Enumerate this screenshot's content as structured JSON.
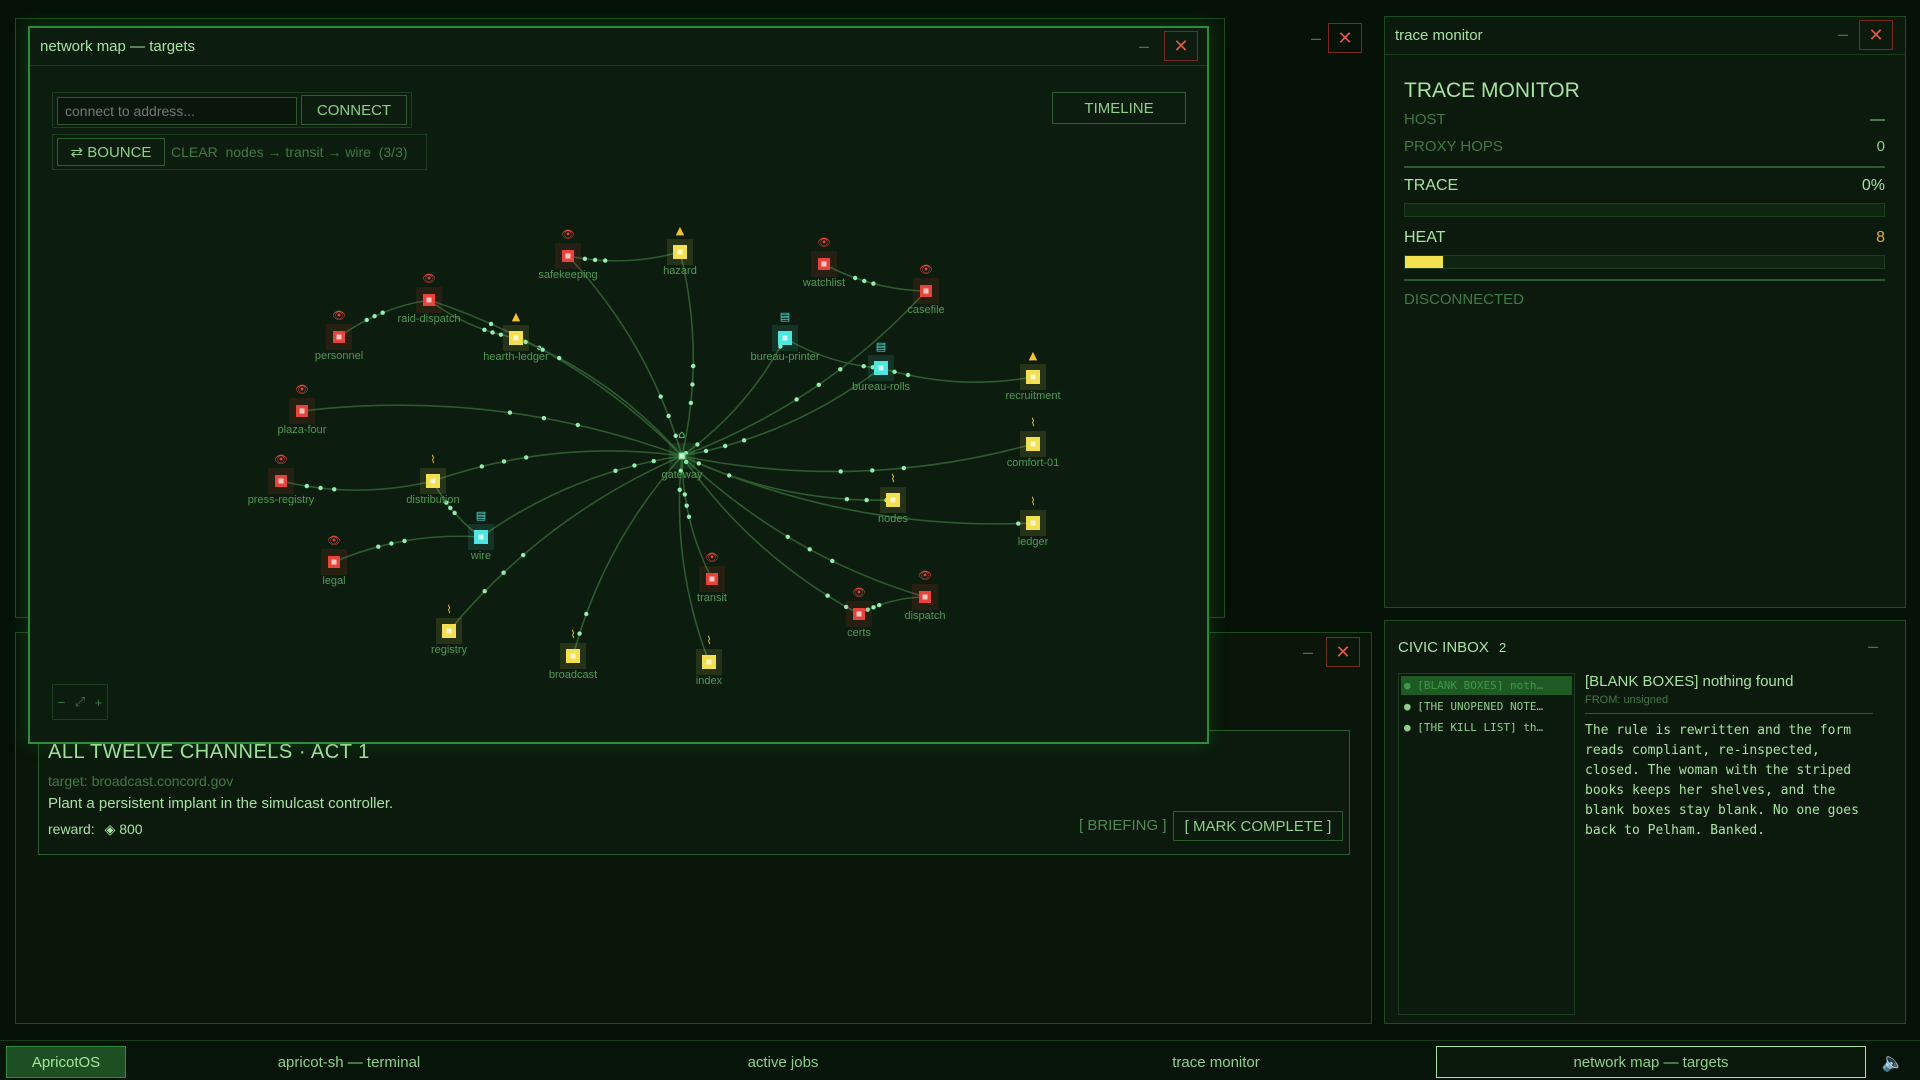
{
  "colors": {
    "background": "#061208",
    "accent_green": "#2f8a3a",
    "node_red": "#e5443a",
    "node_yellow": "#f2e050",
    "node_cyan": "#4ee6e0",
    "heat_bar": "#f2e050"
  },
  "terminal_window": {
    "close_icon": "close-icon"
  },
  "jobs_window": {
    "close_icon": "close-icon"
  },
  "mission": {
    "title": "ALL TWELVE CHANNELS  ·  ACT 1",
    "target": "target: broadcast.concord.gov",
    "description": "Plant a persistent implant in the simulcast controller.",
    "reward_label": "reward:",
    "reward_value": "◈ 800",
    "briefing_label": "[ BRIEFING ]",
    "mark_complete_label": "[ MARK COMPLETE ]"
  },
  "trace_window": {
    "title": "trace monitor",
    "heading": "TRACE MONITOR",
    "host_label": "HOST",
    "host_value": "—",
    "proxy_label": "PROXY HOPS",
    "proxy_value": "0",
    "trace_label": "TRACE",
    "trace_value": "0%",
    "trace_fraction": 0,
    "heat_label": "HEAT",
    "heat_value": "8",
    "heat_fraction": 0.08,
    "status": "DISCONNECTED"
  },
  "inbox_window": {
    "title": "CIVIC INBOX",
    "count": "2",
    "messages": [
      "[BLANK BOXES] noth…",
      "[THE UNOPENED NOTE…",
      "[THE KILL LIST] th…"
    ],
    "selected_subject": "[BLANK BOXES] nothing found",
    "selected_from": "FROM: unsigned",
    "selected_body": "The rule is rewritten and the form reads compliant, re-inspected, closed. The woman with the striped books keeps her shelves, and the blank boxes stay blank. No one goes back to Pelham. Banked."
  },
  "map_window": {
    "title": "network map — targets",
    "address_placeholder": "connect to address...",
    "connect_label": "CONNECT",
    "timeline_label": "TIMELINE",
    "bounce_label": "⇄ BOUNCE",
    "bounce_status": "CLEAR  nodes → transit → wire  (3/3)",
    "zoom_out": "−",
    "zoom_fit": "⤢",
    "zoom_in": "+"
  },
  "network_nodes": [
    {
      "label": "gateway",
      "kind": "home",
      "color": "green"
    },
    {
      "label": "safekeeping",
      "kind": "eye",
      "color": "red"
    },
    {
      "label": "hazard",
      "kind": "flame",
      "color": "yellow"
    },
    {
      "label": "watchlist",
      "kind": "eye",
      "color": "red"
    },
    {
      "label": "casefile",
      "kind": "eye",
      "color": "red"
    },
    {
      "label": "raid-dispatch",
      "kind": "eye",
      "color": "red"
    },
    {
      "label": "hearth-ledger",
      "kind": "flame",
      "color": "yellow"
    },
    {
      "label": "personnel",
      "kind": "eye",
      "color": "red"
    },
    {
      "label": "bureau-printer",
      "kind": "doc",
      "color": "cyan"
    },
    {
      "label": "bureau-rolls",
      "kind": "doc",
      "color": "cyan"
    },
    {
      "label": "recruitment",
      "kind": "flame",
      "color": "yellow"
    },
    {
      "label": "plaza-four",
      "kind": "eye",
      "color": "red"
    },
    {
      "label": "comfort-01",
      "kind": "signal",
      "color": "yellow"
    },
    {
      "label": "press-registry",
      "kind": "eye",
      "color": "red"
    },
    {
      "label": "distribution",
      "kind": "signal",
      "color": "yellow"
    },
    {
      "label": "nodes",
      "kind": "signal",
      "color": "yellow"
    },
    {
      "label": "ledger",
      "kind": "signal",
      "color": "yellow"
    },
    {
      "label": "wire",
      "kind": "doc",
      "color": "cyan"
    },
    {
      "label": "legal",
      "kind": "eye",
      "color": "red"
    },
    {
      "label": "transit",
      "kind": "eye",
      "color": "red"
    },
    {
      "label": "dispatch",
      "kind": "eye",
      "color": "red"
    },
    {
      "label": "certs",
      "kind": "eye",
      "color": "red"
    },
    {
      "label": "registry",
      "kind": "signal",
      "color": "yellow"
    },
    {
      "label": "broadcast",
      "kind": "signal",
      "color": "yellow"
    },
    {
      "label": "index",
      "kind": "signal",
      "color": "yellow"
    }
  ],
  "taskbar": {
    "start_label": "ApricotOS",
    "items": [
      "apricot-sh — terminal",
      "active jobs",
      "trace monitor",
      "network map — targets"
    ],
    "volume_icon": "speaker-icon"
  }
}
